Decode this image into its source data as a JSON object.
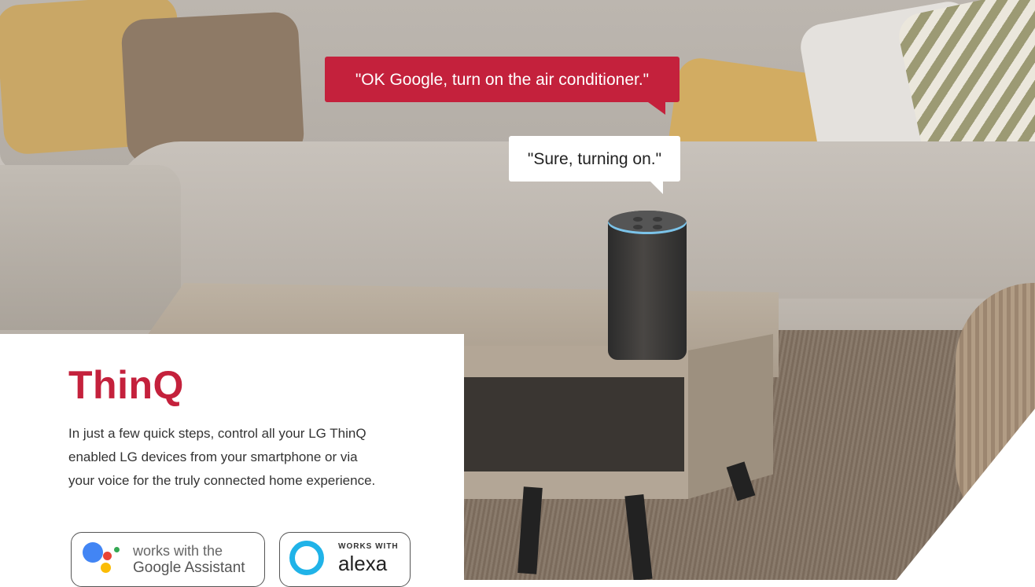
{
  "hero": {
    "bubble_command": "\"OK Google, turn on the air conditioner.\"",
    "bubble_reply": "\"Sure, turning on.\""
  },
  "panel": {
    "title": "ThinQ",
    "description": "In just a few quick steps, control all your LG ThinQ enabled LG devices from your smartphone or via your voice for the truly connected home experience.",
    "badges": {
      "google": {
        "line1": "works with the",
        "line2": "Google Assistant",
        "icon": "google-assistant-icon"
      },
      "alexa": {
        "line1": "WORKS WITH",
        "line2": "alexa",
        "icon": "alexa-icon"
      }
    }
  },
  "colors": {
    "brand": "#c4213c",
    "alexa": "#20b3e8"
  }
}
